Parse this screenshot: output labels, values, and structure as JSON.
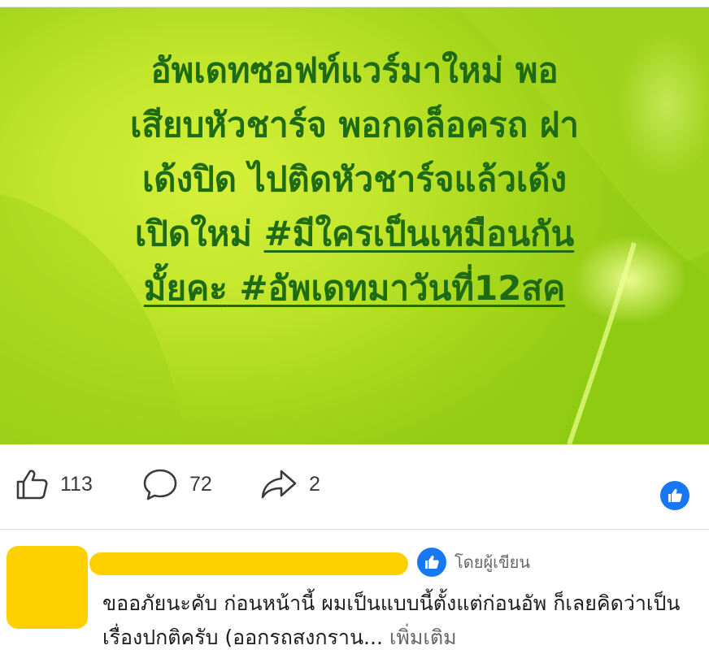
{
  "post": {
    "text_line_1": "อัพเดทซอฟท์แวร์มาใหม่ พอ",
    "text_line_2": "เสียบหัวชาร์จ พอกดล็อครถ ฝา",
    "text_line_3": "เด้งปิด ไปติดหัวชาร์จแล้วเด้ง",
    "text_line_4_plain": "เปิดใหม่ ",
    "text_line_4_tag": "#มีใครเป็นเหมือนกัน",
    "text_line_5_tag_end": "มั้ยคะ",
    "text_line_5_tag2": " #อัพเดทมาวันที่12สค",
    "text_color": "#1f6b14",
    "background_color": "#b8e024"
  },
  "actions": {
    "like_count": "113",
    "comment_count": "72",
    "share_count": "2",
    "like_icon": "thumbs-up-outline-icon",
    "comment_icon": "speech-bubble-icon",
    "share_icon": "share-arrow-icon",
    "reaction_icon": "like-reaction-icon",
    "reaction_color": "#1877f2"
  },
  "comment": {
    "author_badge_label": "โดยผู้เขียน",
    "body": "ขออภัยนะคับ ก่อนหน้านี้ ผมเป็นแบบนี้ตั้งแต่ก่อนอัพ ก็เลยคิดว่าเป็นเรื่องปกติครับ (ออกรถสงกราน...",
    "see_more": "เพิ่มเติม",
    "avatar_redaction_color": "#ffd000"
  }
}
